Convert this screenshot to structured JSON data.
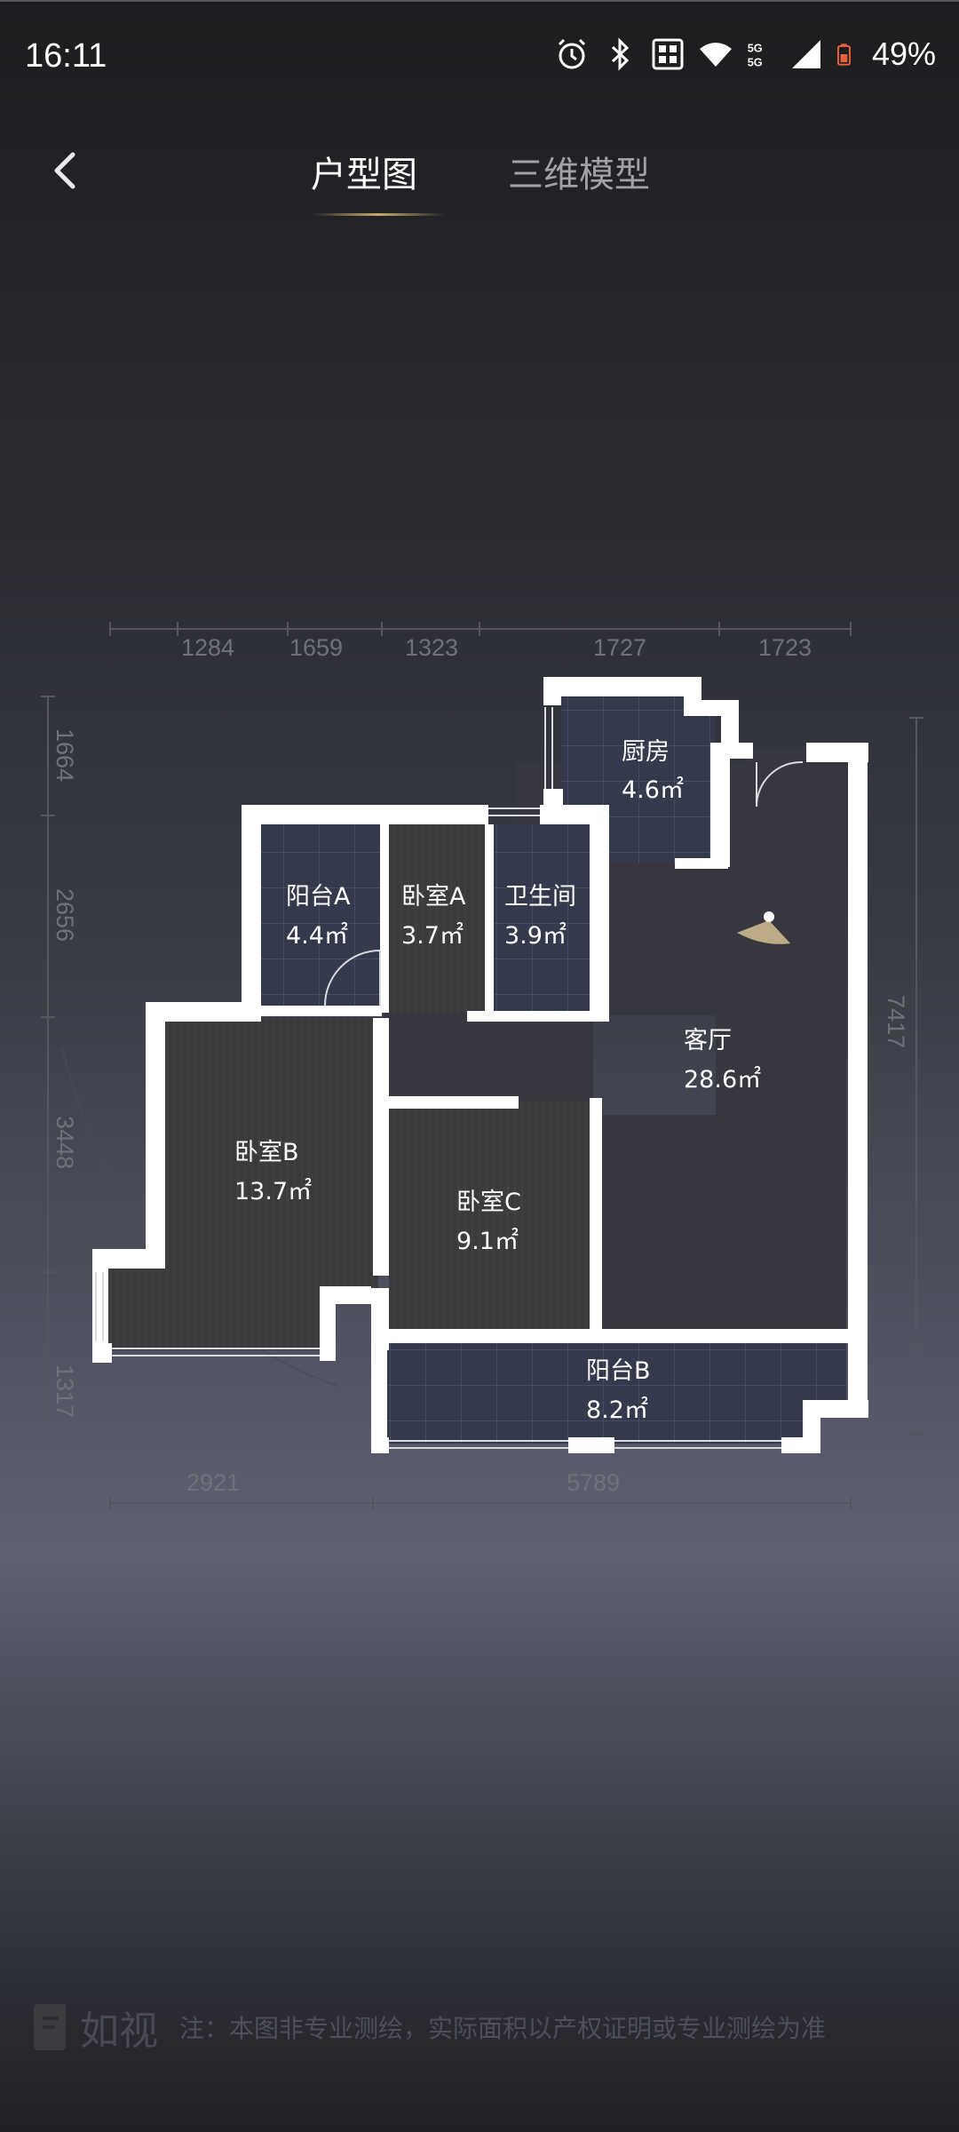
{
  "status_bar": {
    "time": "16:11",
    "battery": "49%",
    "icons": [
      "alarm-icon",
      "bluetooth-icon",
      "sim-icon",
      "wifi-icon",
      "5g-icon",
      "signal-icon",
      "battery-icon"
    ],
    "network_label": "5G"
  },
  "nav": {
    "back_icon": "chevron-left-icon",
    "tabs": [
      {
        "label": "户型图",
        "active": true
      },
      {
        "label": "三维模型",
        "active": false
      }
    ],
    "accent_color": "#c8aa6e"
  },
  "floorplan": {
    "top_dimensions": [
      "1284",
      "1659",
      "1323",
      "1727",
      "1723"
    ],
    "left_dimensions": [
      "1664",
      "2656",
      "3448",
      "1317"
    ],
    "right_dimensions": [
      "7417"
    ],
    "bottom_dimensions": [
      "2921",
      "5789"
    ],
    "rooms": [
      {
        "name": "厨房",
        "area": "4.6㎡"
      },
      {
        "name": "阳台A",
        "area": "4.4㎡"
      },
      {
        "name": "卧室A",
        "area": "3.7㎡"
      },
      {
        "name": "卫生间",
        "area": "3.9㎡"
      },
      {
        "name": "客厅",
        "area": "28.6㎡"
      },
      {
        "name": "卧室B",
        "area": "13.7㎡"
      },
      {
        "name": "卧室C",
        "area": "9.1㎡"
      },
      {
        "name": "阳台B",
        "area": "8.2㎡"
      }
    ]
  },
  "footer": {
    "logo_text": "如视",
    "note": "注：本图非专业测绘，实际面积以产权证明或专业测绘为准"
  }
}
